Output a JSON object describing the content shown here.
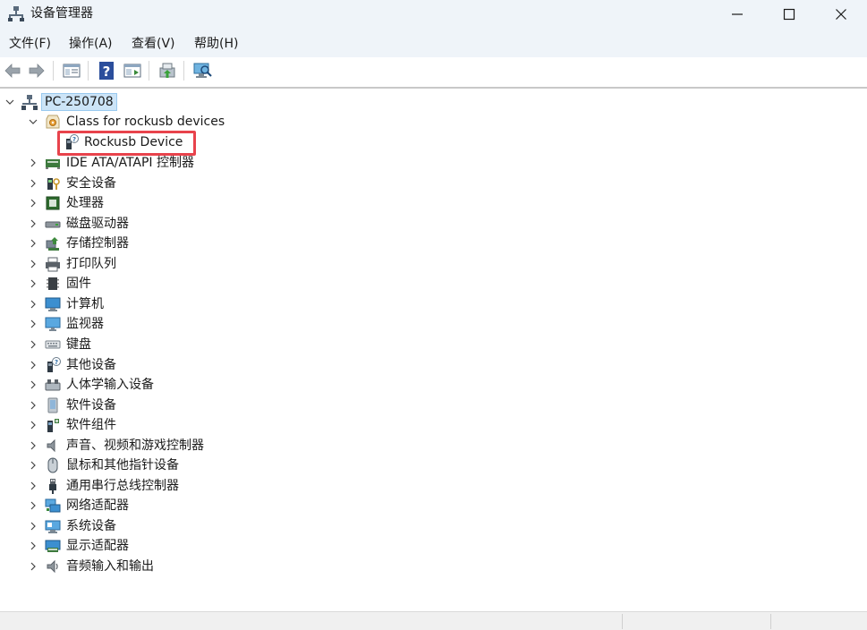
{
  "window": {
    "title": "设备管理器",
    "icon": "device-manager-icon",
    "controls": [
      "minimize-icon",
      "maximize-icon",
      "close-icon"
    ]
  },
  "menu": [
    {
      "label": "文件(F)"
    },
    {
      "label": "操作(A)"
    },
    {
      "label": "查看(V)"
    },
    {
      "label": "帮助(H)"
    }
  ],
  "toolbar": [
    "back-arrow-icon",
    "forward-arrow-icon",
    "properties-icon",
    "help-icon",
    "show-hide-icon",
    "update-driver-icon",
    "scan-hardware-icon"
  ],
  "tree": {
    "root": {
      "label": "PC-250708",
      "expanded": true,
      "icon": "computer-network-icon"
    },
    "expanded_category": {
      "label": "Class for rockusb devices",
      "expanded": true,
      "icon": "rockusb-class-icon"
    },
    "child_device": {
      "label": "Rockusb Device",
      "icon": "unknown-device-icon"
    },
    "categories": [
      {
        "label": "IDE ATA/ATAPI 控制器",
        "icon": "ide-controller-icon"
      },
      {
        "label": "安全设备",
        "icon": "security-device-icon"
      },
      {
        "label": "处理器",
        "icon": "processor-icon"
      },
      {
        "label": "磁盘驱动器",
        "icon": "disk-drive-icon"
      },
      {
        "label": "存储控制器",
        "icon": "storage-controller-icon"
      },
      {
        "label": "打印队列",
        "icon": "printer-icon"
      },
      {
        "label": "固件",
        "icon": "firmware-icon"
      },
      {
        "label": "计算机",
        "icon": "computer-icon"
      },
      {
        "label": "监视器",
        "icon": "monitor-icon"
      },
      {
        "label": "键盘",
        "icon": "keyboard-icon"
      },
      {
        "label": "其他设备",
        "icon": "other-devices-icon"
      },
      {
        "label": "人体学输入设备",
        "icon": "hid-icon"
      },
      {
        "label": "软件设备",
        "icon": "software-device-icon"
      },
      {
        "label": "软件组件",
        "icon": "software-component-icon"
      },
      {
        "label": "声音、视频和游戏控制器",
        "icon": "sound-icon"
      },
      {
        "label": "鼠标和其他指针设备",
        "icon": "mouse-icon"
      },
      {
        "label": "通用串行总线控制器",
        "icon": "usb-icon"
      },
      {
        "label": "网络适配器",
        "icon": "network-adapter-icon"
      },
      {
        "label": "系统设备",
        "icon": "system-device-icon"
      },
      {
        "label": "显示适配器",
        "icon": "display-adapter-icon"
      },
      {
        "label": "音频输入和输出",
        "icon": "audio-io-icon"
      }
    ]
  },
  "colors": {
    "highlight_border": "#e8434c",
    "selection_bg": "#cce4f7",
    "titlebar_bg": "#eff4f9"
  }
}
